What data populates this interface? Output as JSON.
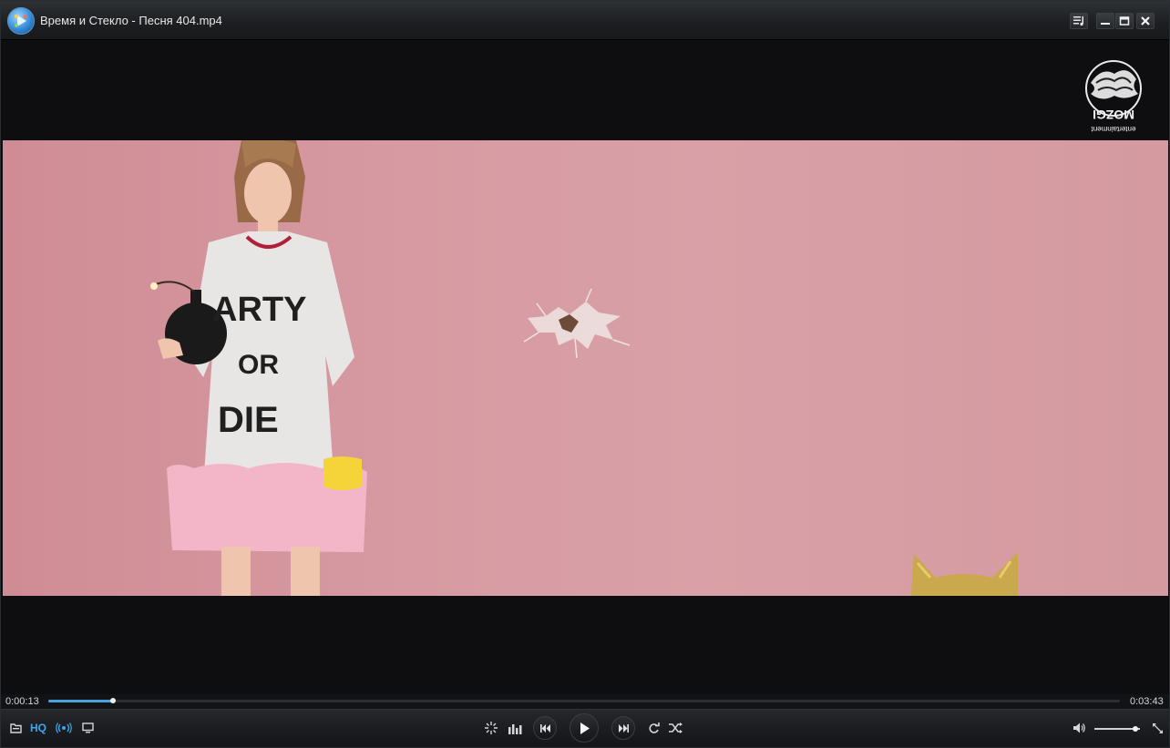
{
  "window": {
    "title": "Время и Стекло - Песня 404.mp4"
  },
  "video": {
    "shirt_text": [
      "ARTY",
      "OR",
      "DIE"
    ],
    "watermark_text": "MOZGI entertainment"
  },
  "playback": {
    "elapsed": "0:00:13",
    "duration": "0:03:43",
    "progress": 0.06,
    "volume": 0.9,
    "quality_label": "HQ"
  },
  "icons": {
    "app": "media-player-icon",
    "playlist": "playlist-icon",
    "minimize": "minimize-icon",
    "maximize": "maximize-icon",
    "close": "close-icon",
    "open": "open-file-icon",
    "broadcast": "broadcast-icon",
    "screen": "screen-icon",
    "effects": "effects-icon",
    "equalizer": "equalizer-icon",
    "prev": "previous-icon",
    "play": "play-icon",
    "next": "next-icon",
    "repeat": "repeat-icon",
    "shuffle": "shuffle-icon",
    "volume": "volume-icon",
    "fullscreen": "fullscreen-icon"
  },
  "colors": {
    "accent": "#4aa3df",
    "background": "#0e0e10",
    "wall": "#d79aa2"
  }
}
